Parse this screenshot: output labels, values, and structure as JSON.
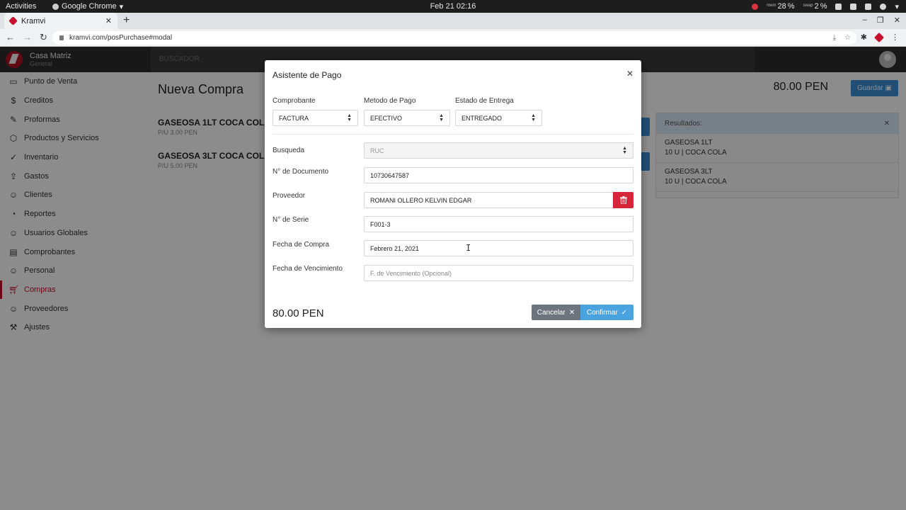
{
  "os": {
    "activities": "Activities",
    "app_name": "Google Chrome",
    "clock": "Feb 21  02:16",
    "mem_label": "mem",
    "mem_value": "28",
    "swap_label": "swap",
    "swap_value": "2"
  },
  "browser": {
    "tab_title": "Kramvi",
    "url": "kramvi.com/posPurchase#modal"
  },
  "app": {
    "brand_name": "Casa Matriz",
    "brand_sub": "General",
    "search_placeholder": "BUSCADOR",
    "sidebar": [
      {
        "label": "Punto de Venta",
        "icon": "monitor-icon"
      },
      {
        "label": "Creditos",
        "icon": "dollar-icon"
      },
      {
        "label": "Proformas",
        "icon": "edit-icon"
      },
      {
        "label": "Productos y Servicios",
        "icon": "box-icon"
      },
      {
        "label": "Inventario",
        "icon": "check-circle-icon"
      },
      {
        "label": "Gastos",
        "icon": "upload-icon"
      },
      {
        "label": "Clientes",
        "icon": "users-icon"
      },
      {
        "label": "Reportes",
        "icon": "pie-chart-icon"
      },
      {
        "label": "Usuarios Globales",
        "icon": "user-check-icon"
      },
      {
        "label": "Comprobantes",
        "icon": "file-icon"
      },
      {
        "label": "Personal",
        "icon": "user-check-icon"
      },
      {
        "label": "Compras",
        "icon": "cart-icon",
        "active": true
      },
      {
        "label": "Proveedores",
        "icon": "user-plus-icon"
      },
      {
        "label": "Ajustes",
        "icon": "wrench-icon"
      }
    ],
    "page_title": "Nueva Compra",
    "products": [
      {
        "name": "GASEOSA 1LT COCA COLA",
        "price": "P/U 3.00 PEN"
      },
      {
        "name": "GASEOSA 3LT COCA COLA",
        "price": "P/U 5.00 PEN"
      }
    ],
    "total": "80.00 PEN",
    "save_label": "Guardar",
    "results": {
      "title": "Resultados:",
      "items": [
        {
          "name": "GASEOSA 1LT",
          "detail": "10 U | COCA COLA"
        },
        {
          "name": "GASEOSA 3LT",
          "detail": "10 U | COCA COLA"
        }
      ]
    }
  },
  "modal": {
    "title": "Asistente de Pago",
    "comprobante_label": "Comprobante",
    "comprobante_value": "FACTURA",
    "metodo_label": "Metodo de Pago",
    "metodo_value": "EFECTIVO",
    "estado_label": "Estado de Entrega",
    "estado_value": "ENTREGADO",
    "busqueda_label": "Busqueda",
    "busqueda_value": "RUC",
    "documento_label": "N° de Documento",
    "documento_value": "10730647587",
    "proveedor_label": "Proveedor",
    "proveedor_value": "ROMANI OLLERO KELVIN EDGAR",
    "serie_label": "N° de Serie",
    "serie_value": "F001-3",
    "fecha_compra_label": "Fecha de Compra",
    "fecha_compra_value": "Febrero 21, 2021",
    "fecha_venc_label": "Fecha de Vencimiento",
    "fecha_venc_placeholder": "F. de Vencimiento (Opcional)",
    "total": "80.00 PEN",
    "cancel_label": "Cancelar",
    "confirm_label": "Confirmar"
  },
  "colors": {
    "brand": "#c8102e",
    "primary": "#4aa3df",
    "danger": "#d6243a",
    "secondary": "#6c757d"
  }
}
